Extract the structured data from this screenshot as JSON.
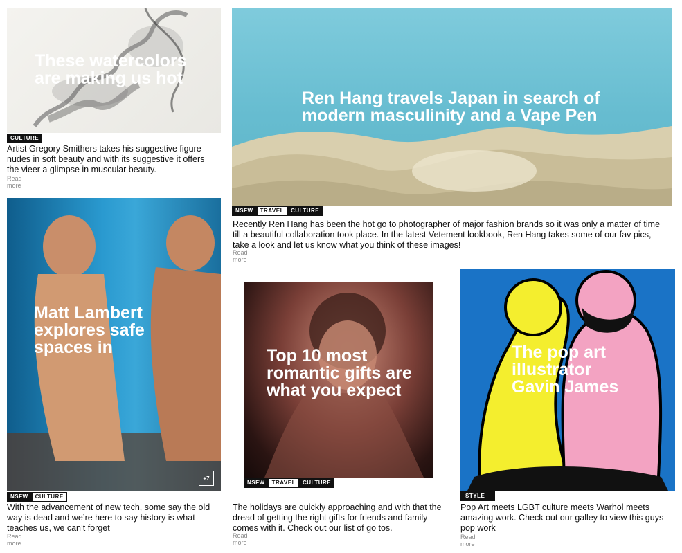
{
  "cards": [
    {
      "headline": "These watercolors are making us hot",
      "tags": [
        "CULTURE"
      ],
      "description": "Artist Gregory Smithers takes his suggestive figure nudes in soft beauty and with its suggestive it offers the vieer a glimpse in muscular beauty.",
      "read_more": "Read more"
    },
    {
      "headline": "Ren Hang travels Japan in search of modern masculinity and a Vape Pen",
      "tags": [
        "NSFW",
        "TRAVEL",
        "CULTURE"
      ],
      "description": "Recently Ren Hang has been the hot go to photographer of major fashion brands so it was only a matter of time till a beautiful collaboration took place. In the latest Vetement lookbook, Ren Hang takes some of our fav pics, take a look and let us know what you think of these images!",
      "read_more": "Read more"
    },
    {
      "headline": "Matt Lambert explores safe spaces in",
      "tags": [
        "NSFW",
        "CULTURE"
      ],
      "description": "With the advancement of new tech, some say the old way is dead and we’re here to say history is what teaches us, we can’t forget",
      "read_more": "Read more",
      "gallery_count": "+7"
    },
    {
      "headline": "Top 10 most romantic gifts are what you expect",
      "tags": [
        "NSFW",
        "TRAVEL",
        "CULTURE"
      ],
      "description": "The holidays are quickly approaching and with that the dread of getting the right gifts for friends and family comes with it. Check out our list of go tos.",
      "read_more": "Read more"
    },
    {
      "headline": "The pop art illustrator Gavin James",
      "tags": [
        "STYLE"
      ],
      "description": "Pop Art meets LGBT culture meets Warhol meets amazing work. Check out our galley to view this guys pop work",
      "read_more": "Read more"
    }
  ],
  "colors": {
    "sky": "#6ec1d3",
    "pop_blue": "#1a73c6",
    "pop_pink": "#f3a3c2",
    "pop_yellow": "#f4ee2e"
  }
}
